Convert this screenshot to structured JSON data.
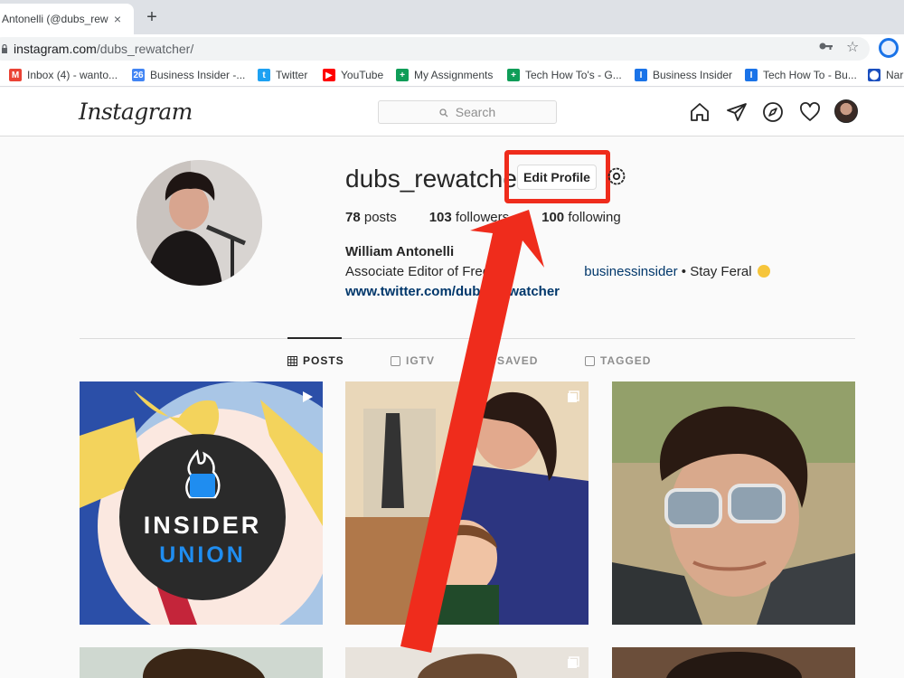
{
  "browser": {
    "tab_title": "Antonelli (@dubs_rewatcher)",
    "tab_close": "×",
    "new_tab": "+",
    "url_host": "instagram.com",
    "url_path": "/dubs_rewatcher/"
  },
  "bookmarks": [
    {
      "label": "Inbox (4) - wanto...",
      "icon": "gmail-icon",
      "color": "#ea4335"
    },
    {
      "label": "Business Insider -...",
      "icon": "calendar-icon",
      "color": "#4285f4"
    },
    {
      "label": "Twitter",
      "icon": "twitter-icon",
      "color": "#1da1f2"
    },
    {
      "label": "YouTube",
      "icon": "youtube-icon",
      "color": "#ff0000"
    },
    {
      "label": "My Assignments",
      "icon": "sheets-icon",
      "color": "#0f9d58"
    },
    {
      "label": "Tech How To's - G...",
      "icon": "sheets-icon",
      "color": "#0f9d58"
    },
    {
      "label": "Business Insider",
      "icon": "insider-icon",
      "color": "#1a73e8"
    },
    {
      "label": "Tech How To - Bu...",
      "icon": "insider-icon",
      "color": "#1a73e8"
    },
    {
      "label": "Nar",
      "icon": "bookmark-icon",
      "color": "#1a4fbf"
    }
  ],
  "instagram": {
    "logo": "Instagram",
    "search_placeholder": "Search"
  },
  "profile": {
    "username": "dubs_rewatcher",
    "edit_button": "Edit Profile",
    "posts_count": "78",
    "posts_label": "posts",
    "followers_count": "103",
    "followers_label": "followers",
    "following_count": "100",
    "following_label": "following",
    "full_name": "William Antonelli",
    "bio_prefix": "Associate Editor of Free",
    "bio_mention": "businessinsider",
    "bio_suffix": " • Stay Feral",
    "website": "www.twitter.com/dubs_rewatcher"
  },
  "profile_tabs": [
    {
      "label": "POSTS",
      "active": true
    },
    {
      "label": "IGTV",
      "active": false
    },
    {
      "label": "SAVED",
      "active": false
    },
    {
      "label": "TAGGED",
      "active": false
    }
  ],
  "posts": {
    "first_post_text_top": "INSIDER",
    "first_post_text_bottom": "UNION"
  },
  "colors": {
    "annotation": "#ef2c1c",
    "link": "#00376b",
    "union_blue": "#1f8df0"
  }
}
